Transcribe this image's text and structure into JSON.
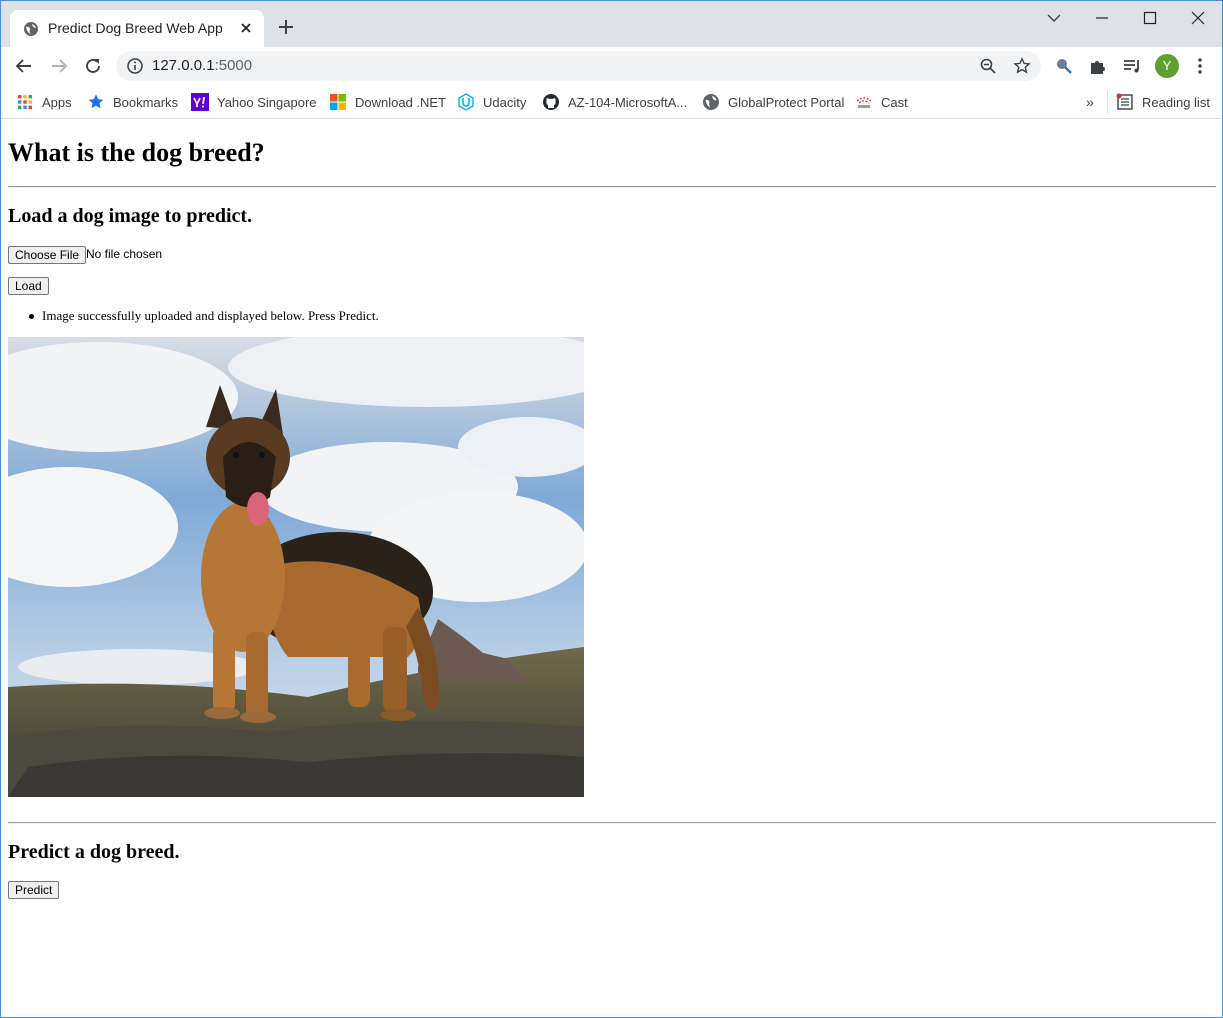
{
  "browser": {
    "tab_title": "Predict Dog Breed Web App",
    "url_host": "127.0.0.1",
    "url_port": ":5000",
    "avatar_letter": "Y",
    "bookmarks": [
      {
        "label": "Apps",
        "icon": "apps-grid-icon"
      },
      {
        "label": "Bookmarks",
        "icon": "star-icon"
      },
      {
        "label": "Yahoo Singapore",
        "icon": "yahoo-icon"
      },
      {
        "label": "Download .NET",
        "icon": "windows-logo-icon"
      },
      {
        "label": "Udacity",
        "icon": "udacity-icon"
      },
      {
        "label": "AZ-104-MicrosoftA...",
        "icon": "github-icon"
      },
      {
        "label": "GlobalProtect Portal",
        "icon": "globe-icon"
      },
      {
        "label": "Cast",
        "icon": "cast-icon"
      }
    ],
    "more_bookmarks": "»",
    "reading_list": "Reading list"
  },
  "page": {
    "title": "What is the dog breed?",
    "load_heading": "Load a dog image to predict.",
    "choose_file_label": "Choose File",
    "no_file_text": "No file chosen",
    "load_button": "Load",
    "upload_message": "Image successfully uploaded and displayed below. Press Predict.",
    "predict_heading": "Predict a dog breed.",
    "predict_button": "Predict"
  }
}
